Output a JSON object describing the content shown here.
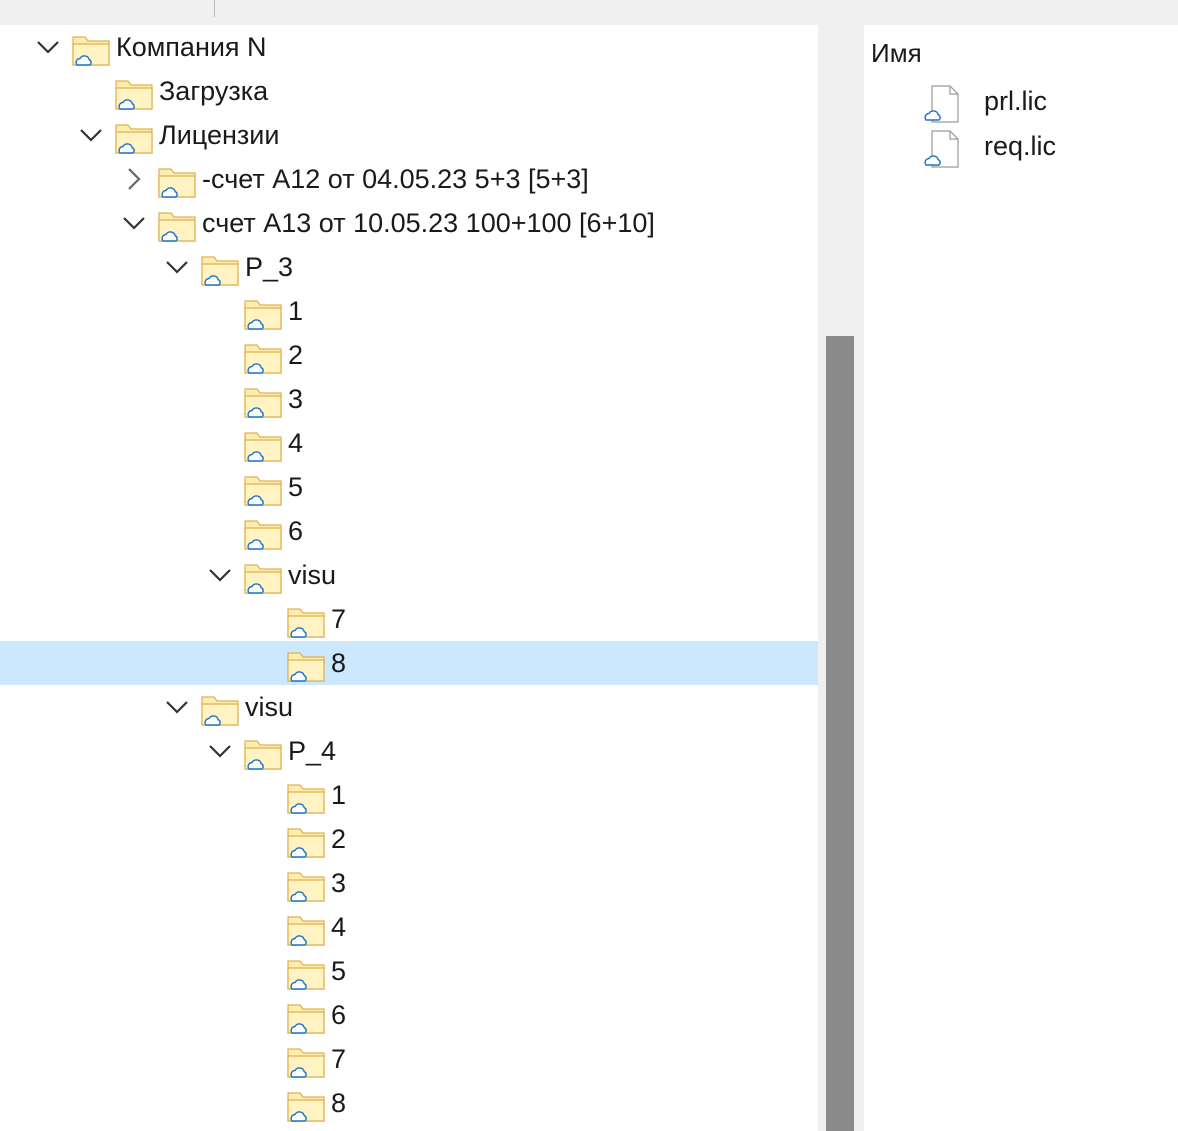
{
  "nav_tree": {
    "rows": [
      {
        "label": "Компания N",
        "level": 0,
        "expander": "expanded"
      },
      {
        "label": "Загрузка",
        "level": 1,
        "expander": "none"
      },
      {
        "label": "Лицензии",
        "level": 1,
        "expander": "expanded"
      },
      {
        "label": "-счет А12 от 04.05.23 5+3 [5+3]",
        "level": 2,
        "expander": "collapsed"
      },
      {
        "label": "счет А13 от 10.05.23 100+100 [6+10]",
        "level": 2,
        "expander": "expanded"
      },
      {
        "label": "P_3",
        "level": 3,
        "expander": "expanded"
      },
      {
        "label": "1",
        "level": 4,
        "expander": "none"
      },
      {
        "label": "2",
        "level": 4,
        "expander": "none"
      },
      {
        "label": "3",
        "level": 4,
        "expander": "none"
      },
      {
        "label": "4",
        "level": 4,
        "expander": "none"
      },
      {
        "label": "5",
        "level": 4,
        "expander": "none"
      },
      {
        "label": "6",
        "level": 4,
        "expander": "none"
      },
      {
        "label": "visu",
        "level": 4,
        "expander": "expanded"
      },
      {
        "label": "7",
        "level": 5,
        "expander": "none"
      },
      {
        "label": "8",
        "level": 5,
        "expander": "none",
        "selected": true
      },
      {
        "label": "visu",
        "level": 3,
        "expander": "expanded"
      },
      {
        "label": "P_4",
        "level": 4,
        "expander": "expanded"
      },
      {
        "label": "1",
        "level": 5,
        "expander": "none"
      },
      {
        "label": "2",
        "level": 5,
        "expander": "none"
      },
      {
        "label": "3",
        "level": 5,
        "expander": "none"
      },
      {
        "label": "4",
        "level": 5,
        "expander": "none"
      },
      {
        "label": "5",
        "level": 5,
        "expander": "none"
      },
      {
        "label": "6",
        "level": 5,
        "expander": "none"
      },
      {
        "label": "7",
        "level": 5,
        "expander": "none"
      },
      {
        "label": "8",
        "level": 5,
        "expander": "none"
      }
    ]
  },
  "content_pane": {
    "column_header": "Имя",
    "files": [
      {
        "name": "prl.lic"
      },
      {
        "name": "req.lic"
      }
    ]
  },
  "icons": {
    "folder": "folder-cloud-icon",
    "file": "file-cloud-icon",
    "expanded": "chevron-down-icon",
    "collapsed": "chevron-right-icon"
  },
  "colors": {
    "selection": "#cce8ff",
    "folder_fill": "#fdeeb0",
    "folder_stroke": "#e0b04a",
    "cloud_stroke": "#1e73c8",
    "scroll_thumb": "#8a8a8a",
    "chrome": "#f0f0f0"
  }
}
